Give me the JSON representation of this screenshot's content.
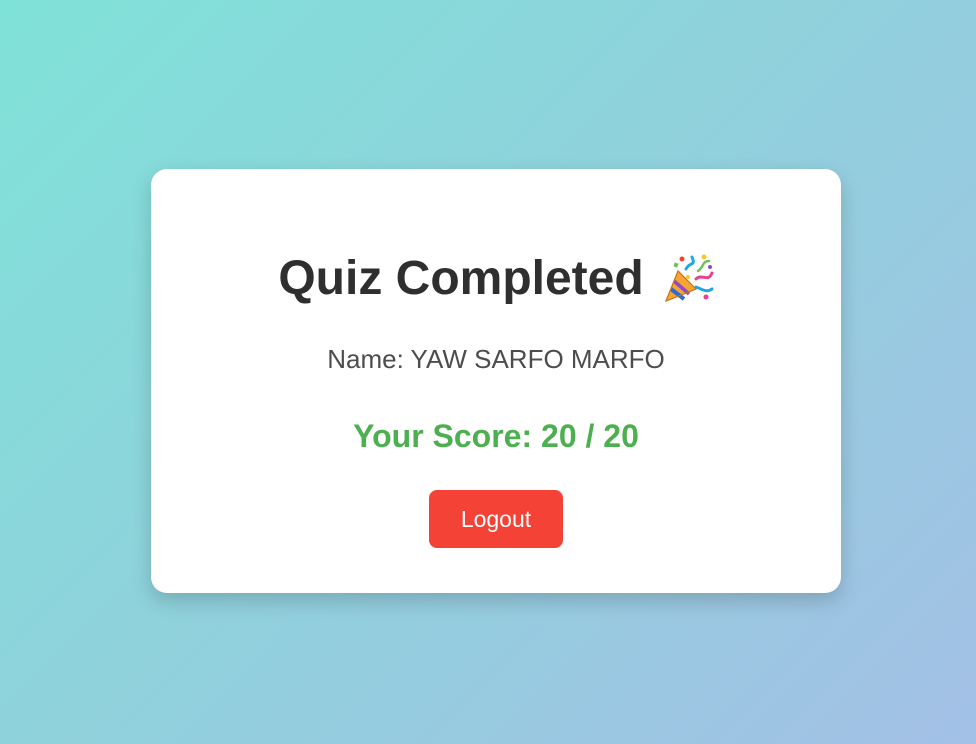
{
  "card": {
    "title": "Quiz Completed",
    "title_icon": "party-popper-icon",
    "name_label": "Name: YAW SARFO MARFO",
    "score_label": "Your Score: 20 / 20",
    "score": {
      "value": 20,
      "max": 20
    },
    "logout_label": "Logout"
  },
  "colors": {
    "background_gradient_start": "#7fe2d8",
    "background_gradient_end": "#a3c0e6",
    "card_background": "#ffffff",
    "title_text": "#2f2f2f",
    "name_text": "#4d4d4d",
    "score_text": "#4caf50",
    "logout_button": "#f44336",
    "logout_text": "#ffffff"
  }
}
